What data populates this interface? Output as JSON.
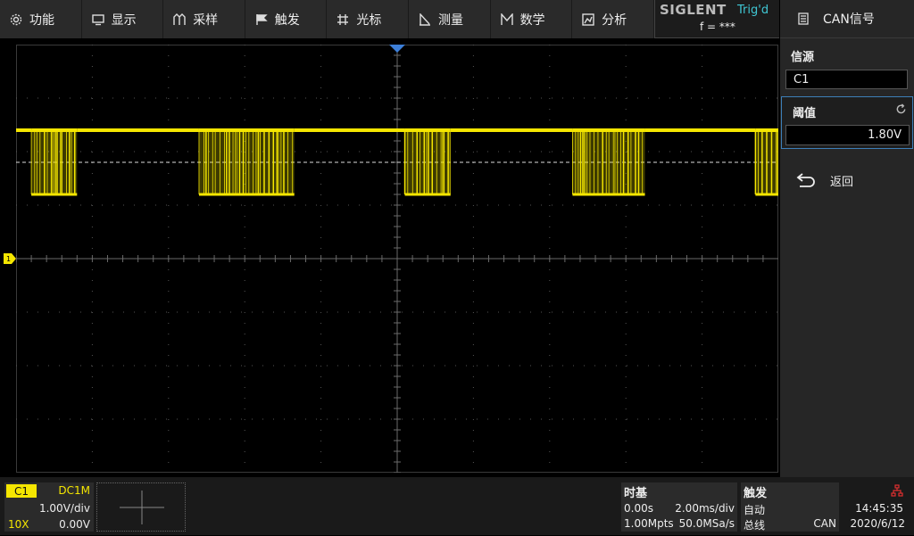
{
  "menu": [
    {
      "label": "功能",
      "icon": "gear-icon"
    },
    {
      "label": "显示",
      "icon": "monitor-icon"
    },
    {
      "label": "采样",
      "icon": "sampling-icon"
    },
    {
      "label": "触发",
      "icon": "flag-icon"
    },
    {
      "label": "光标",
      "icon": "cursor-crosshair-icon"
    },
    {
      "label": "测量",
      "icon": "measure-icon"
    },
    {
      "label": "数学",
      "icon": "math-icon"
    },
    {
      "label": "分析",
      "icon": "analysis-icon"
    }
  ],
  "brand": {
    "name": "SIGLENT",
    "trig_status": "Trig'd",
    "frequency": "f = ***"
  },
  "side_panel": {
    "title": "CAN信号",
    "source_label": "信源",
    "source_value": "C1",
    "threshold_label": "阈值",
    "threshold_value": "1.80V",
    "back_label": "返回"
  },
  "channel": {
    "name": "C1",
    "coupling": "DC1M",
    "volts_per_div": "1.00V/div",
    "probe": "10X",
    "offset": "0.00V",
    "color": "#f5e600"
  },
  "timebase": {
    "header": "时基",
    "delay": "0.00s",
    "time_per_div": "2.00ms/div",
    "memory_depth": "1.00Mpts",
    "sample_rate": "50.0MSa/s"
  },
  "trigger": {
    "header": "触发",
    "mode": "自动",
    "type": "总线",
    "source": "CAN"
  },
  "clock": {
    "time": "14:45:35",
    "date": "2020/6/12"
  },
  "waveform": {
    "color": "#f5e600",
    "bursts": [
      0.02,
      0.24,
      0.51,
      0.73,
      0.97
    ]
  }
}
